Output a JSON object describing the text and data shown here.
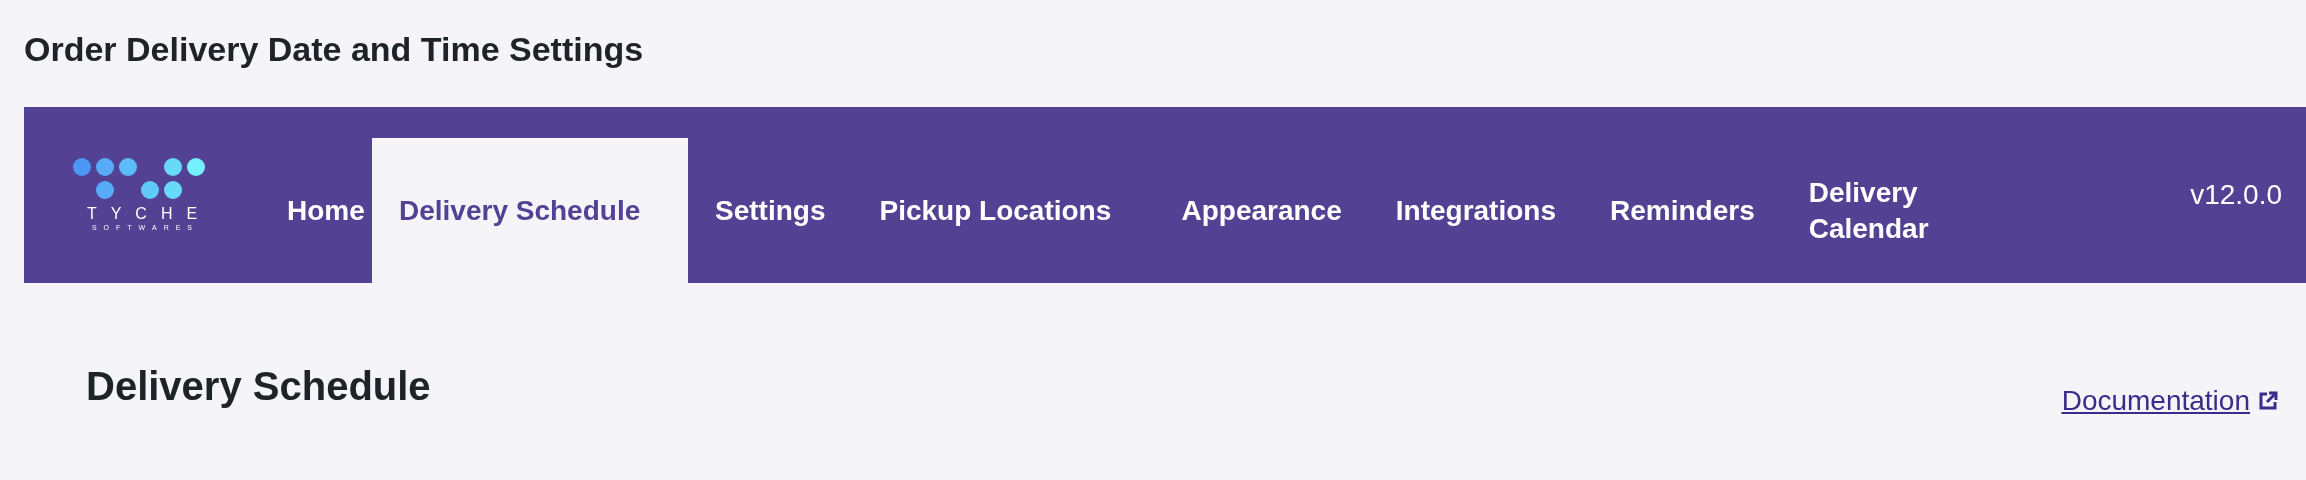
{
  "page_title": "Order Delivery Date and Time Settings",
  "logo": {
    "name": "TYCHE",
    "tagline": "SOFTWARES"
  },
  "tabs": [
    {
      "label": "Home",
      "selected": false
    },
    {
      "label": "Delivery Schedule",
      "selected": true
    },
    {
      "label": "Settings",
      "selected": false
    },
    {
      "label": "Pickup Locations",
      "selected": false
    },
    {
      "label": "Appearance",
      "selected": false
    },
    {
      "label": "Integrations",
      "selected": false
    },
    {
      "label": "Reminders",
      "selected": false
    },
    {
      "label": "Delivery Calendar",
      "selected": false
    }
  ],
  "version": "v12.0.0",
  "section": {
    "heading": "Delivery Schedule",
    "link": "Documentation"
  }
}
